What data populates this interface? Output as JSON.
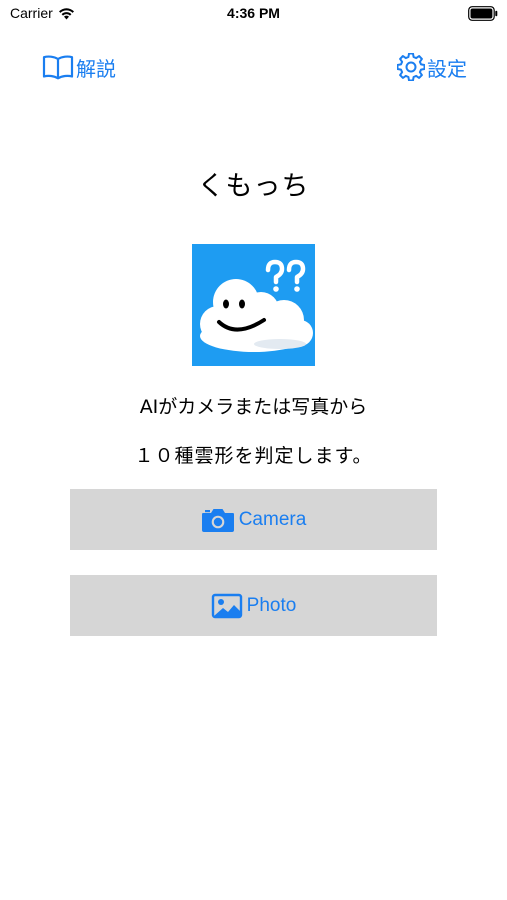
{
  "status_bar": {
    "carrier": "Carrier",
    "time": "4:36 PM"
  },
  "nav": {
    "left_label": "解説",
    "right_label": "設定",
    "left_icon": "book-icon",
    "right_icon": "gear-icon"
  },
  "main": {
    "title": "くもっち",
    "description_line1": "AIがカメラまたは写真から",
    "description_line2": "１０種雲形を判定します。"
  },
  "buttons": {
    "camera_label": "Camera",
    "photo_label": "Photo",
    "camera_icon": "camera-icon",
    "photo_icon": "photo-icon"
  },
  "colors": {
    "accent": "#1a7ef0",
    "button_bg": "#d6d6d6",
    "logo_bg": "#1e9cf2"
  }
}
